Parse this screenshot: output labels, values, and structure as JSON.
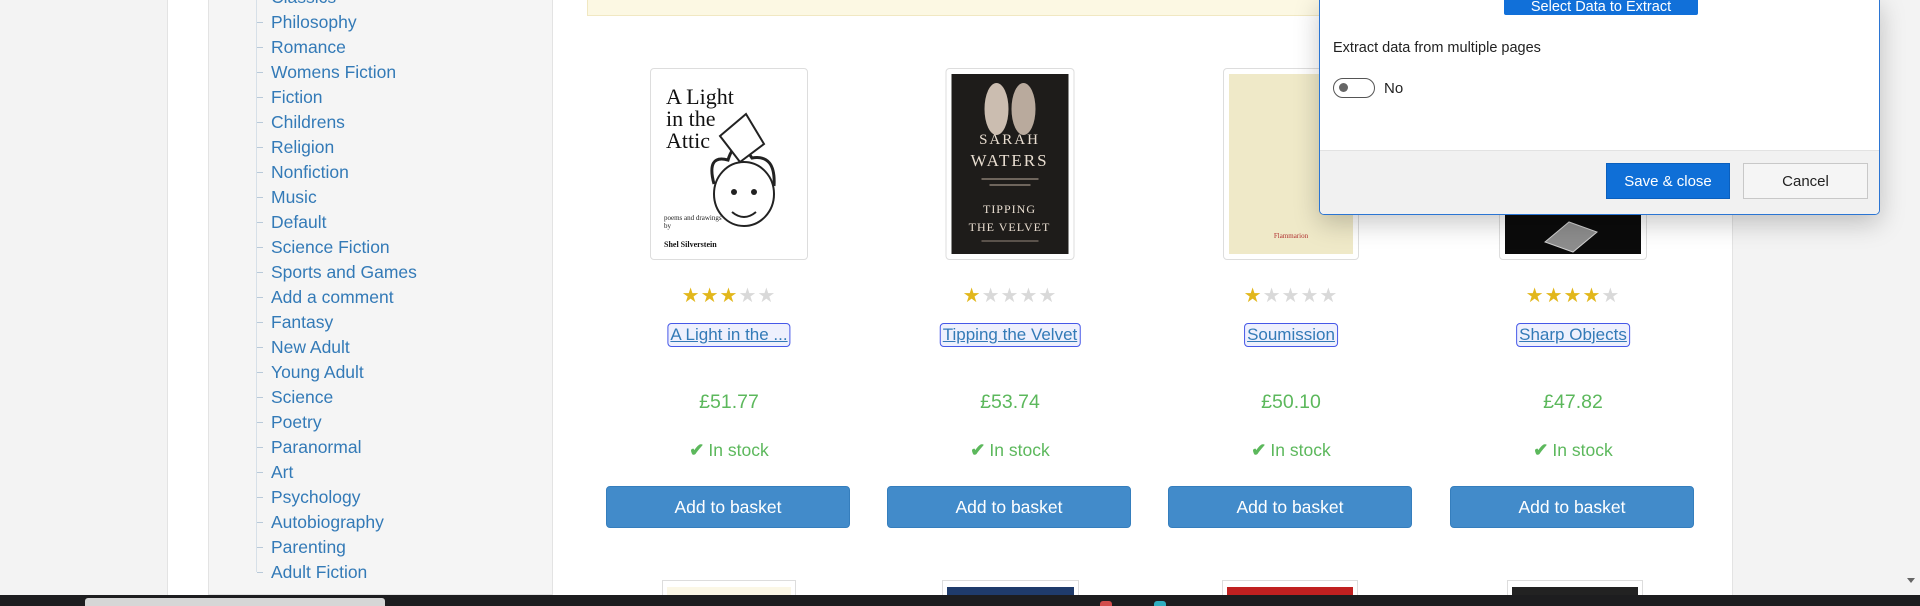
{
  "sidebar": {
    "categories": [
      "Classics",
      "Philosophy",
      "Romance",
      "Womens Fiction",
      "Fiction",
      "Childrens",
      "Religion",
      "Nonfiction",
      "Music",
      "Default",
      "Science Fiction",
      "Sports and Games",
      "Add a comment",
      "Fantasy",
      "New Adult",
      "Young Adult",
      "Science",
      "Poetry",
      "Paranormal",
      "Art",
      "Psychology",
      "Autobiography",
      "Parenting",
      "Adult Fiction"
    ]
  },
  "products": [
    {
      "title": "A Light in the ...",
      "price": "£51.77",
      "rating": 3,
      "availability": "In stock",
      "button_label": "Add to basket",
      "cover": {
        "title_lines": [
          "A Light",
          "in the",
          "Attic"
        ],
        "subtitle": "poems and drawings by",
        "author": "Shel Silverstein"
      }
    },
    {
      "title": "Tipping the Velvet",
      "price": "£53.74",
      "rating": 1,
      "availability": "In stock",
      "button_label": "Add to basket",
      "cover": {
        "author_lines": [
          "SARAH",
          "WATERS"
        ],
        "title_lines": [
          "TIPPING",
          "THE VELVET"
        ]
      }
    },
    {
      "title": "Soumission",
      "price": "£50.10",
      "rating": 1,
      "availability": "In stock",
      "button_label": "Add to basket",
      "cover": {
        "text": "Flammarion"
      }
    },
    {
      "title": "Sharp Objects",
      "price": "£47.82",
      "rating": 4,
      "availability": "In stock",
      "button_label": "Add to basket",
      "cover": {}
    }
  ],
  "dialog": {
    "select_button": "Select Data to Extract",
    "multi_page_label": "Extract data from multiple pages",
    "toggle_text": "No",
    "toggle_on": false,
    "save_button": "Save & close",
    "cancel_button": "Cancel"
  },
  "colors": {
    "link": "#337ab7",
    "price": "#5cb85c",
    "button": "#428bca",
    "star": "#e2b71c",
    "dialog_primary": "#0f6fd7"
  },
  "icons": {
    "stock": "check-icon",
    "rating": "star-icon"
  }
}
